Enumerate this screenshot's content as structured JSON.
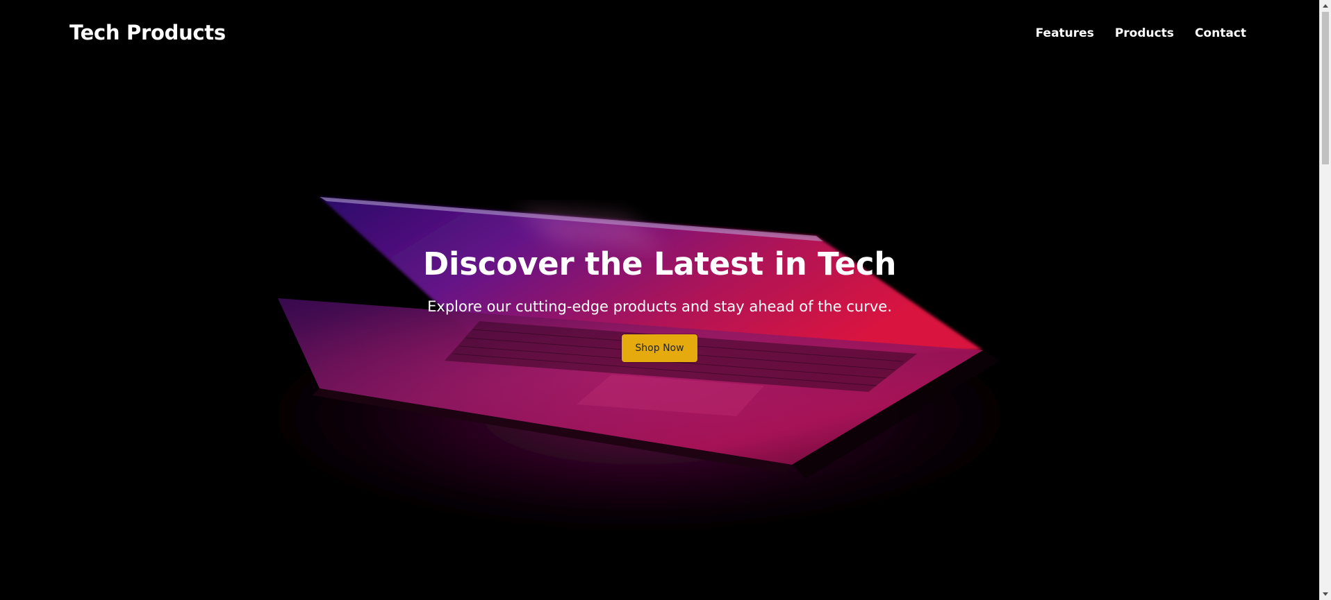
{
  "navbar": {
    "brand": "Tech Products",
    "links": [
      "Features",
      "Products",
      "Contact"
    ]
  },
  "hero": {
    "title": "Discover the Latest in Tech",
    "subtitle": "Explore our cutting-edge products and stay ahead of the curve.",
    "cta_label": "Shop Now",
    "background_image": "laptop-photo",
    "cta_color": "#e5aa0d"
  },
  "colors": {
    "background": "#000000",
    "text": "#ffffff",
    "accent_pink": "#c0155a",
    "accent_purple": "#5a1480"
  }
}
